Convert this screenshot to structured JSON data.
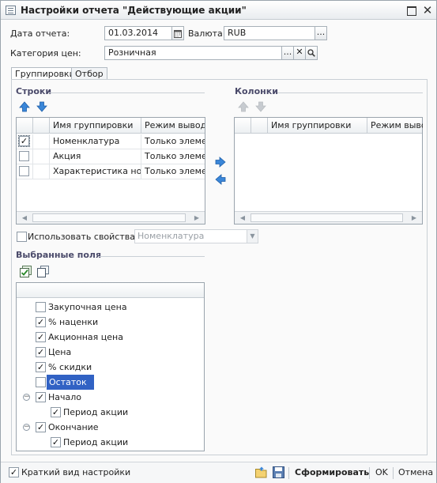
{
  "window": {
    "title": "Настройки отчета  \"Действующие акции\""
  },
  "form": {
    "date_label": "Дата отчета:",
    "date_value": "01.03.2014",
    "currency_label": "Валюта:",
    "currency_value": "RUB",
    "price_category_label": "Категория цен:",
    "price_category_value": "Розничная"
  },
  "tabs": [
    {
      "label": "Группировки",
      "active": true
    },
    {
      "label": "Отбор",
      "active": false
    }
  ],
  "rows_section": {
    "title": "Строки",
    "columns": [
      "Имя группировки",
      "Режим вывода"
    ],
    "rows": [
      {
        "checked": true,
        "name": "Номенклатура",
        "mode": "Только элеме..."
      },
      {
        "checked": false,
        "name": "Акция",
        "mode": "Только элеме..."
      },
      {
        "checked": false,
        "name": "Характеристика но...",
        "mode": "Только элеме..."
      }
    ]
  },
  "columns_section": {
    "title": "Колонки",
    "columns": [
      "Имя группировки",
      "Режим выво"
    ]
  },
  "use_properties": {
    "label": "Использовать свойства",
    "checked": false,
    "combo_value": "Номенклатура"
  },
  "selected_fields": {
    "title": "Выбранные поля",
    "items": [
      {
        "label": "Закупочная цена",
        "checked": false,
        "level": 0
      },
      {
        "label": "% наценки",
        "checked": true,
        "level": 0
      },
      {
        "label": "Акционная цена",
        "checked": true,
        "level": 0
      },
      {
        "label": "Цена",
        "checked": true,
        "level": 0
      },
      {
        "label": "% скидки",
        "checked": true,
        "level": 0
      },
      {
        "label": "Остаток",
        "checked": false,
        "level": 0,
        "selected": true
      },
      {
        "label": "Начало",
        "checked": true,
        "level": 0,
        "expanded": true
      },
      {
        "label": "Период акции",
        "checked": true,
        "level": 1
      },
      {
        "label": "Окончание",
        "checked": true,
        "level": 0,
        "expanded": true
      },
      {
        "label": "Период акции",
        "checked": true,
        "level": 1
      }
    ]
  },
  "footer": {
    "short_view_label": "Краткий вид настройки",
    "short_view_checked": true,
    "generate_label": "Сформировать",
    "ok_label": "OK",
    "cancel_label": "Отмена"
  },
  "icons": {
    "calendar": "calendar-icon",
    "ellipsis": "ellipsis-icon",
    "clear": "clear-icon",
    "search": "search-icon",
    "move_up": "arrow-up-icon",
    "move_down": "arrow-down-icon",
    "move_right": "arrow-right-icon",
    "move_left": "arrow-left-icon",
    "check_all": "check-all-icon",
    "copy": "copy-icon",
    "open": "open-folder-icon",
    "save": "save-icon"
  },
  "colors": {
    "selection": "#3162c4",
    "arrow_blue": "#3a86d8"
  }
}
